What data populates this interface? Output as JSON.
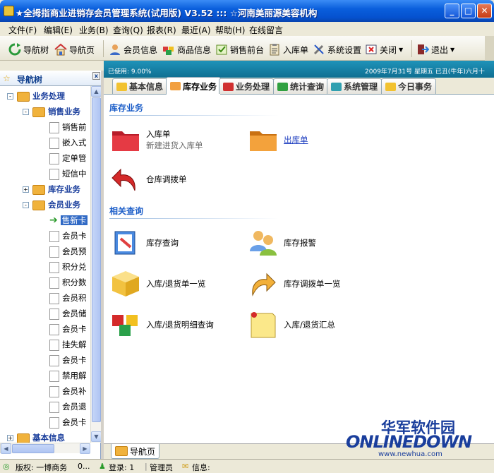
{
  "window": {
    "title": "★全拇指商业进销存会员管理系统(试用版) V3.52  :::  ☆河南美丽源美容机构"
  },
  "menu": [
    "文件(F)",
    "编辑(E)",
    "业务(B)",
    "查询(Q)",
    "报表(R)",
    "最近(A)",
    "帮助(H)",
    "在线留言"
  ],
  "toolbar": [
    {
      "label": "导航树",
      "icon": "refresh-icon"
    },
    {
      "label": "导航页",
      "icon": "home-icon"
    },
    {
      "label": "会员信息",
      "icon": "member-icon"
    },
    {
      "label": "商品信息",
      "icon": "product-icon"
    },
    {
      "label": "销售前台",
      "icon": "sales-icon"
    },
    {
      "label": "入库单",
      "icon": "clipboard-icon"
    },
    {
      "label": "系统设置",
      "icon": "tools-icon"
    },
    {
      "label": "关闭",
      "icon": "close-window-icon"
    },
    {
      "label": "退出",
      "icon": "exit-icon"
    }
  ],
  "nav": {
    "header": "导航树",
    "tree": [
      {
        "label": "业务处理",
        "level": 0,
        "type": "folder",
        "expander": "-"
      },
      {
        "label": "销售业务",
        "level": 1,
        "type": "folder",
        "expander": "-"
      },
      {
        "label": "销售前",
        "level": 2,
        "type": "doc"
      },
      {
        "label": "嵌入式",
        "level": 2,
        "type": "doc"
      },
      {
        "label": "定单管",
        "level": 2,
        "type": "doc"
      },
      {
        "label": "短信中",
        "level": 2,
        "type": "doc"
      },
      {
        "label": "库存业务",
        "level": 1,
        "type": "folder",
        "expander": "+"
      },
      {
        "label": "会员业务",
        "level": 1,
        "type": "folder",
        "expander": "-"
      },
      {
        "label": "售新卡",
        "level": 2,
        "type": "arrow",
        "selected": true
      },
      {
        "label": "会员卡",
        "level": 2,
        "type": "doc"
      },
      {
        "label": "会员预",
        "level": 2,
        "type": "doc"
      },
      {
        "label": "积分兑",
        "level": 2,
        "type": "doc"
      },
      {
        "label": "积分数",
        "level": 2,
        "type": "doc"
      },
      {
        "label": "会员积",
        "level": 2,
        "type": "doc"
      },
      {
        "label": "会员储",
        "level": 2,
        "type": "doc"
      },
      {
        "label": "会员卡",
        "level": 2,
        "type": "doc"
      },
      {
        "label": "挂失解",
        "level": 2,
        "type": "doc"
      },
      {
        "label": "会员卡",
        "level": 2,
        "type": "doc"
      },
      {
        "label": "禁用解",
        "level": 2,
        "type": "doc"
      },
      {
        "label": "会员补",
        "level": 2,
        "type": "doc"
      },
      {
        "label": "会员退",
        "level": 2,
        "type": "doc"
      },
      {
        "label": "会员卡",
        "level": 2,
        "type": "doc"
      },
      {
        "label": "基本信息",
        "level": 0,
        "type": "folder",
        "expander": "+"
      }
    ]
  },
  "infobar": {
    "left": "已使用: 9.00%",
    "right": "2009年7月31号 星期五  已丑(牛年)六月十"
  },
  "tabs": [
    {
      "label": "基本信息",
      "color": "#f2c230"
    },
    {
      "label": "库存业务",
      "color": "#f2a040",
      "active": true
    },
    {
      "label": "业务处理",
      "color": "#d03030"
    },
    {
      "label": "统计查询",
      "color": "#30a040"
    },
    {
      "label": "系统管理",
      "color": "#30a0b0"
    },
    {
      "label": "今日事务",
      "color": "#f2c230"
    }
  ],
  "content": {
    "section1": "库存业务",
    "section2": "相关查询",
    "items1": [
      {
        "label": "入库单",
        "sub": "新建进货入库单",
        "icon": "red-folder-icon"
      },
      {
        "label": "出库单",
        "link": true,
        "icon": "orange-folder-icon"
      },
      {
        "label": "仓库调拨单",
        "icon": "curved-arrow-icon"
      }
    ],
    "items2": [
      {
        "label": "库存查询",
        "icon": "search-doc-icon"
      },
      {
        "label": "库存报警",
        "icon": "users-icon"
      },
      {
        "label": "入库/退货单一览",
        "icon": "box-icon"
      },
      {
        "label": "库存调拨单一览",
        "icon": "forward-arrow-icon"
      },
      {
        "label": "入库/退货明细查询",
        "icon": "cubes-icon"
      },
      {
        "label": "入库/退货汇总",
        "icon": "note-icon"
      }
    ]
  },
  "bottomtab": "导航页",
  "status": {
    "copyright": "版权: 一博商务",
    "dots": "0...",
    "login": "登录: 1",
    "user": "管理员",
    "info": "信息:"
  },
  "watermark": {
    "cn": "华军软件园",
    "en": "ONLINEDOWN",
    "url": "www.newhua.com"
  }
}
